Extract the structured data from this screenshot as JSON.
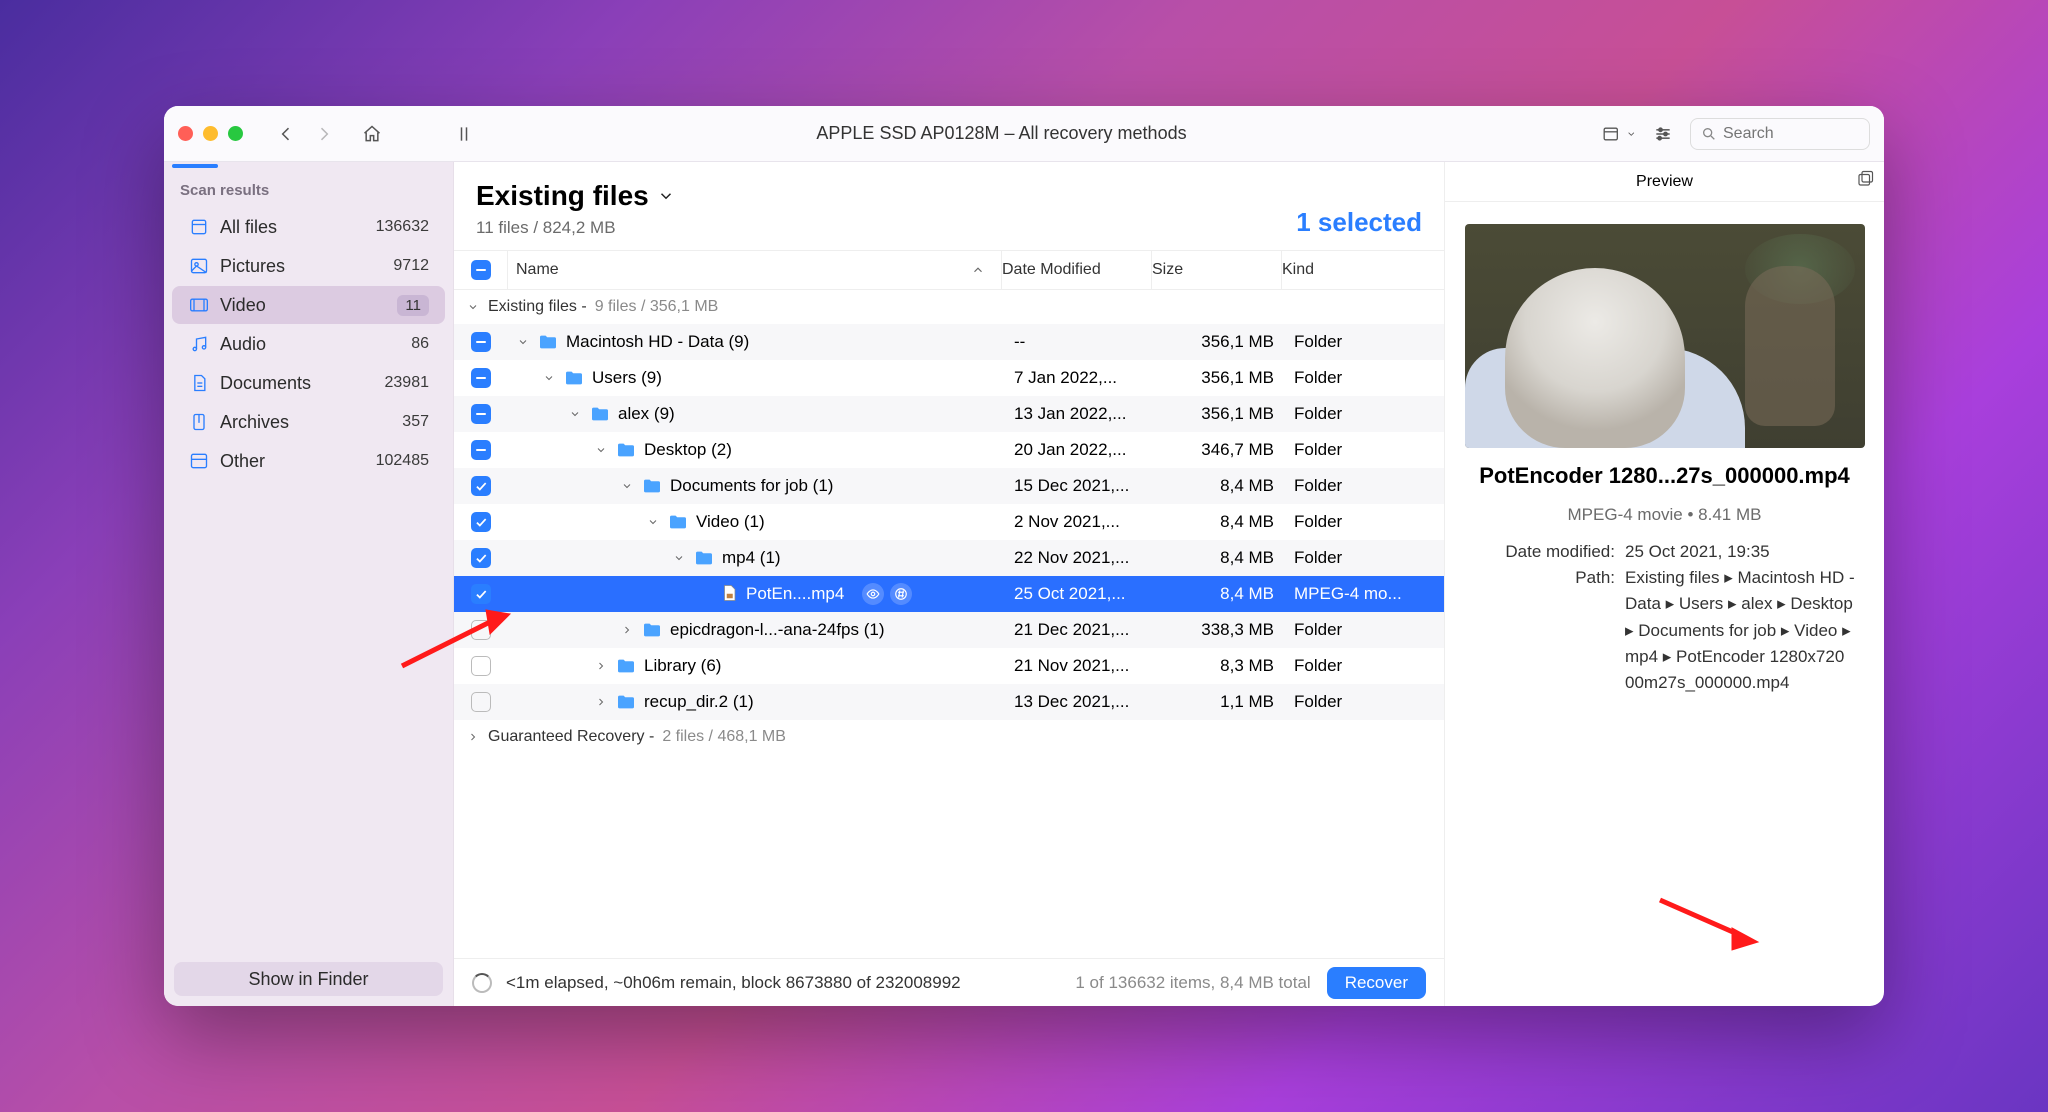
{
  "window_title": "APPLE SSD AP0128M – All recovery methods",
  "search_placeholder": "Search",
  "sidebar": {
    "header": "Scan results",
    "items": [
      {
        "icon": "files",
        "label": "All files",
        "count": "136632"
      },
      {
        "icon": "pictures",
        "label": "Pictures",
        "count": "9712"
      },
      {
        "icon": "video",
        "label": "Video",
        "count": "11",
        "selected": true
      },
      {
        "icon": "audio",
        "label": "Audio",
        "count": "86"
      },
      {
        "icon": "documents",
        "label": "Documents",
        "count": "23981"
      },
      {
        "icon": "archives",
        "label": "Archives",
        "count": "357"
      },
      {
        "icon": "other",
        "label": "Other",
        "count": "102485"
      }
    ],
    "footer_button": "Show in Finder"
  },
  "header": {
    "title": "Existing files",
    "subtitle": "11 files / 824,2 MB",
    "selected_label": "1 selected"
  },
  "columns": {
    "name": "Name",
    "date": "Date Modified",
    "size": "Size",
    "kind": "Kind"
  },
  "groups": [
    {
      "label": "Existing files -",
      "meta": "9 files / 356,1 MB"
    },
    {
      "label": "Guaranteed Recovery -",
      "meta": "2 files / 468,1 MB"
    }
  ],
  "rows": [
    {
      "indent": 0,
      "chk": "minus",
      "disclosure": "down",
      "icon": "folder",
      "name": "Macintosh HD - Data (9)",
      "date": "--",
      "size": "356,1 MB",
      "kind": "Folder"
    },
    {
      "indent": 1,
      "chk": "minus",
      "disclosure": "down",
      "icon": "folder",
      "name": "Users (9)",
      "date": "7 Jan 2022,...",
      "size": "356,1 MB",
      "kind": "Folder"
    },
    {
      "indent": 2,
      "chk": "minus",
      "disclosure": "down",
      "icon": "folder",
      "name": "alex (9)",
      "date": "13 Jan 2022,...",
      "size": "356,1 MB",
      "kind": "Folder"
    },
    {
      "indent": 3,
      "chk": "minus",
      "disclosure": "down",
      "icon": "folder",
      "name": "Desktop (2)",
      "date": "20 Jan 2022,...",
      "size": "346,7 MB",
      "kind": "Folder"
    },
    {
      "indent": 4,
      "chk": "checked",
      "disclosure": "down",
      "icon": "folder",
      "name": "Documents for job (1)",
      "date": "15 Dec 2021,...",
      "size": "8,4 MB",
      "kind": "Folder"
    },
    {
      "indent": 5,
      "chk": "checked",
      "disclosure": "down",
      "icon": "folder",
      "name": "Video (1)",
      "date": "2 Nov 2021,...",
      "size": "8,4 MB",
      "kind": "Folder"
    },
    {
      "indent": 6,
      "chk": "checked",
      "disclosure": "down",
      "icon": "folder",
      "name": "mp4 (1)",
      "date": "22 Nov 2021,...",
      "size": "8,4 MB",
      "kind": "Folder"
    },
    {
      "indent": 7,
      "chk": "checked",
      "disclosure": "",
      "icon": "file",
      "name": "PotEn....mp4",
      "date": "25 Oct 2021,...",
      "size": "8,4 MB",
      "kind": "MPEG-4 mo...",
      "selected": true,
      "badges": true
    },
    {
      "indent": 4,
      "chk": "empty",
      "disclosure": "right",
      "icon": "folder",
      "name": "epicdragon-l...-ana-24fps (1)",
      "date": "21 Dec 2021,...",
      "size": "338,3 MB",
      "kind": "Folder"
    },
    {
      "indent": 3,
      "chk": "empty",
      "disclosure": "right",
      "icon": "folder",
      "name": "Library (6)",
      "date": "21 Nov 2021,...",
      "size": "8,3 MB",
      "kind": "Folder"
    },
    {
      "indent": 3,
      "chk": "empty",
      "disclosure": "right",
      "icon": "folder",
      "name": "recup_dir.2 (1)",
      "date": "13 Dec 2021,...",
      "size": "1,1 MB",
      "kind": "Folder"
    }
  ],
  "preview": {
    "header": "Preview",
    "filename": "PotEncoder 1280...27s_000000.mp4",
    "type_size": "MPEG-4 movie • 8.41 MB",
    "date_label": "Date modified:",
    "date_value": "25 Oct 2021, 19:35",
    "path_label": "Path:",
    "path_value": "Existing files ▸ Macintosh HD - Data ▸ Users ▸ alex ▸ Desktop ▸ Documents for job ▸ Video ▸ mp4 ▸ PotEncoder 1280x720 00m27s_000000.mp4"
  },
  "status": {
    "progress_text": "<1m elapsed, ~0h06m remain, block 8673880 of 232008992",
    "summary": "1 of 136632 items, 8,4 MB total",
    "recover_label": "Recover"
  }
}
